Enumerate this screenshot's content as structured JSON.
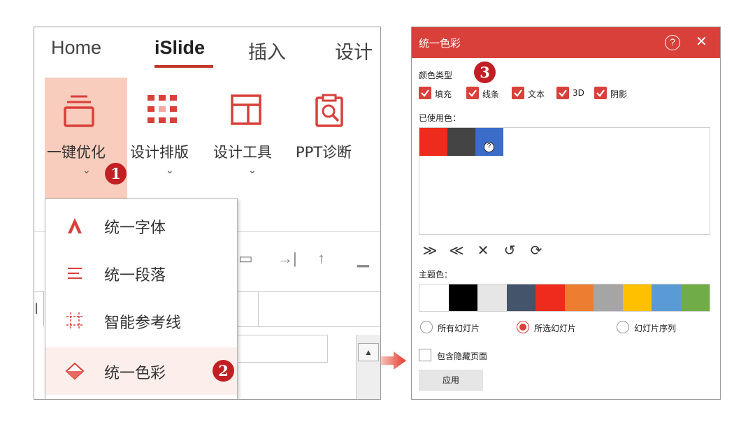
{
  "ribbon": {
    "tabs": [
      {
        "label": "Home",
        "active": false
      },
      {
        "label": "iSlide",
        "active": true
      },
      {
        "label": "插入",
        "active": false
      },
      {
        "label": "设计",
        "active": false
      }
    ],
    "buttons": [
      {
        "label": "一键优化",
        "icon": "layers-icon"
      },
      {
        "label": "设计排版",
        "icon": "grid-layout-icon"
      },
      {
        "label": "设计工具",
        "icon": "panel-layout-icon"
      },
      {
        "label": "PPT诊断",
        "icon": "clipboard-search-icon"
      }
    ],
    "accent_color": "#c0392b",
    "highlight_color": "#f9cdbd"
  },
  "dropdown": {
    "items": [
      {
        "label": "统一字体",
        "icon": "font-a-icon"
      },
      {
        "label": "统一段落",
        "icon": "paragraph-lines-icon"
      },
      {
        "label": "智能参考线",
        "icon": "guide-lines-icon"
      },
      {
        "label": "统一色彩",
        "icon": "color-diamond-icon",
        "hovered": true
      }
    ]
  },
  "badges": [
    "1",
    "2",
    "3"
  ],
  "dialog": {
    "title": "统一色彩",
    "header_color": "#d9403a",
    "help_symbol": "?",
    "close_symbol": "✕",
    "color_type_label": "颜色类型",
    "color_types": [
      {
        "label": "填充",
        "checked": true
      },
      {
        "label": "线条",
        "checked": true
      },
      {
        "label": "文本",
        "checked": true
      },
      {
        "label": "3D",
        "checked": true
      },
      {
        "label": "阴影",
        "checked": true
      }
    ],
    "used_colors_label": "已使用色：",
    "used_colors": [
      "#ee2b1c",
      "#444444",
      "#3b6cc9"
    ],
    "unknown_symbol": "?",
    "tools": [
      {
        "name": "move-down-icon",
        "glyph": "≫"
      },
      {
        "name": "move-up-icon",
        "glyph": "≪"
      },
      {
        "name": "delete-icon",
        "glyph": "✕"
      },
      {
        "name": "undo-icon",
        "glyph": "↺"
      },
      {
        "name": "refresh-icon",
        "glyph": "⟳"
      }
    ],
    "theme_colors_label": "主题色：",
    "theme_colors": [
      "#ffffff",
      "#000000",
      "#e7e6e6",
      "#44546a",
      "#ee2b1c",
      "#ed7d31",
      "#a5a5a5",
      "#ffc000",
      "#5b9bd5",
      "#70ad47"
    ],
    "scope_options": [
      {
        "label": "所有幻灯片",
        "selected": false
      },
      {
        "label": "所选幻灯片",
        "selected": true
      },
      {
        "label": "幻灯片序列",
        "selected": false
      }
    ],
    "include_hidden_label": "包含隐藏页面",
    "include_hidden_checked": false,
    "apply_label": "应用"
  }
}
